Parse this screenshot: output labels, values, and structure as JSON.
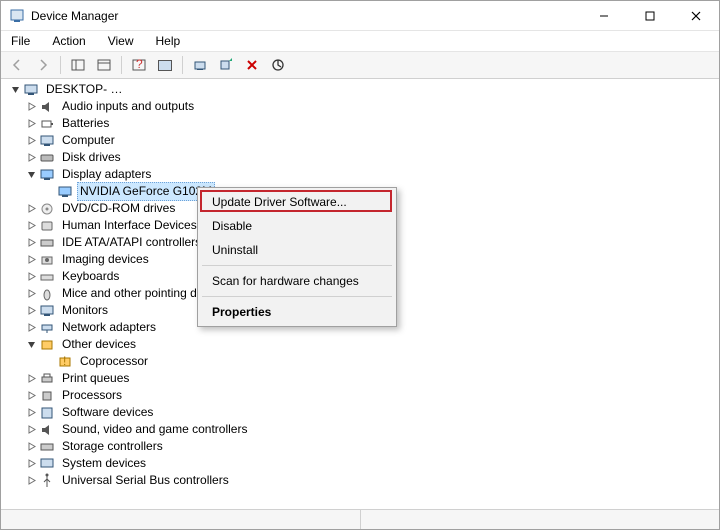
{
  "window": {
    "title": "Device Manager"
  },
  "menu": {
    "file": "File",
    "action": "Action",
    "view": "View",
    "help": "Help"
  },
  "tree": {
    "root": "DESKTOP-  …",
    "display_adapters": "Display adapters",
    "selected_device": "NVIDIA GeForce G102M",
    "other_devices": "Other devices",
    "coprocessor": "Coprocessor",
    "items": {
      "audio": "Audio inputs and outputs",
      "batteries": "Batteries",
      "computer": "Computer",
      "disk": "Disk drives",
      "dvd": "DVD/CD-ROM drives",
      "hid": "Human Interface Devices",
      "ide": "IDE ATA/ATAPI controllers",
      "imaging": "Imaging devices",
      "keyboards": "Keyboards",
      "mice": "Mice and other pointing devices",
      "monitors": "Monitors",
      "network": "Network adapters",
      "printq": "Print queues",
      "processors": "Processors",
      "software": "Software devices",
      "sound": "Sound, video and game controllers",
      "storage": "Storage controllers",
      "system": "System devices",
      "usb": "Universal Serial Bus controllers"
    }
  },
  "context_menu": {
    "update": "Update Driver Software...",
    "disable": "Disable",
    "uninstall": "Uninstall",
    "scan": "Scan for hardware changes",
    "properties": "Properties"
  }
}
